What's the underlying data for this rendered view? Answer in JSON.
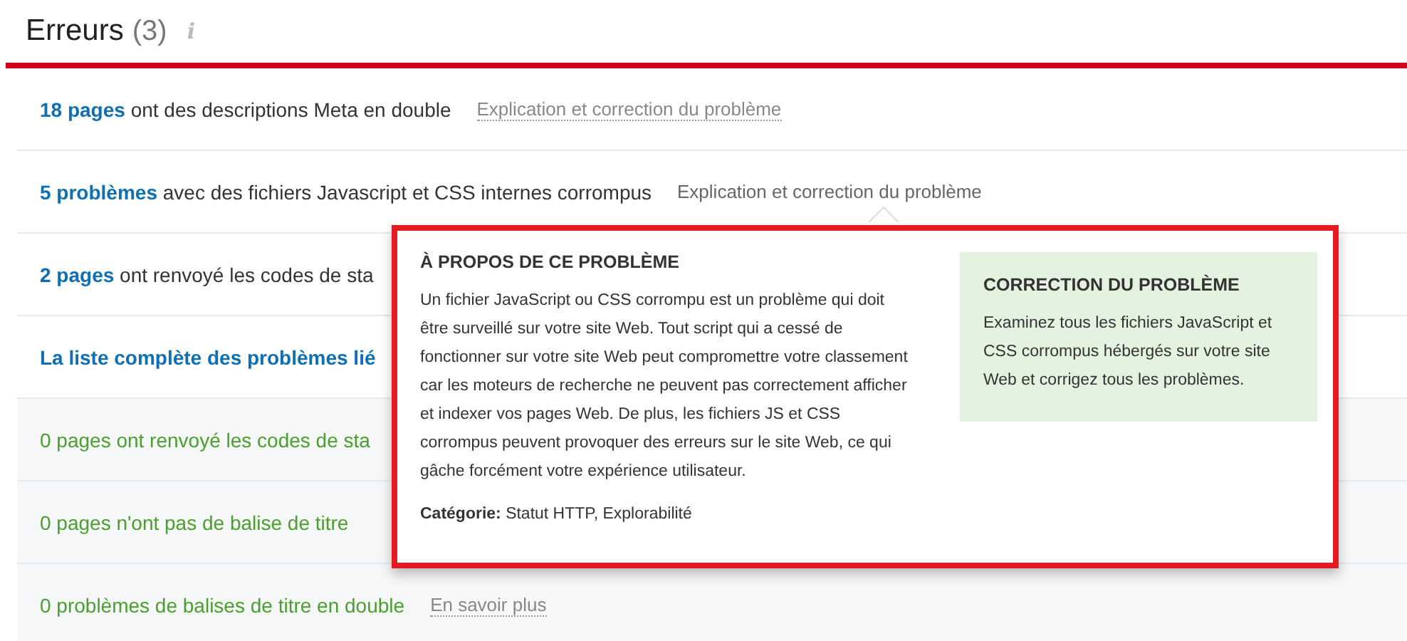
{
  "header": {
    "title": "Erreurs",
    "count": "(3)",
    "info": "i"
  },
  "rows": [
    {
      "kind": "error",
      "lead": "18 pages",
      "text": "ont des descriptions Meta en double",
      "link": {
        "label": "Explication et correction du problème",
        "active": false
      }
    },
    {
      "kind": "error",
      "lead": "5 problèmes",
      "text": "avec des fichiers Javascript et CSS internes corrompus",
      "link": {
        "label": "Explication et correction du problème",
        "active": true
      }
    },
    {
      "kind": "error",
      "lead": "2 pages",
      "text": "ont renvoyé les codes de sta"
    },
    {
      "kind": "error",
      "lead": "La liste complète des problèmes lié"
    },
    {
      "kind": "ok",
      "text": "0 pages ont renvoyé les codes de sta"
    },
    {
      "kind": "ok",
      "text": "0 pages n'ont pas de balise de titre"
    },
    {
      "kind": "ok",
      "text": "0 problèmes de balises de titre en double",
      "link": {
        "label": "En savoir plus",
        "active": false
      }
    }
  ],
  "popup": {
    "about": {
      "title": "À PROPOS DE CE PROBLÈME",
      "body": "Un fichier JavaScript ou CSS corrompu est un problème qui doit être surveillé sur votre site Web. Tout script qui a cessé de fonctionner sur votre site Web peut compromettre votre classement car les moteurs de recherche ne peuvent pas correctement afficher et indexer vos pages Web. De plus, les fichiers JS et CSS corrompus peuvent provoquer des erreurs sur le site Web, ce qui gâche forcément votre expérience utilisateur.",
      "category": "**Catégorie:** Statut HTTP, Explorabilité"
    },
    "fix": {
      "title": "CORRECTION DU PROBLÈME",
      "body": "Examinez tous les fichiers JavaScript et CSS corrompus hébergés sur votre site Web et corrigez tous les problèmes."
    }
  }
}
